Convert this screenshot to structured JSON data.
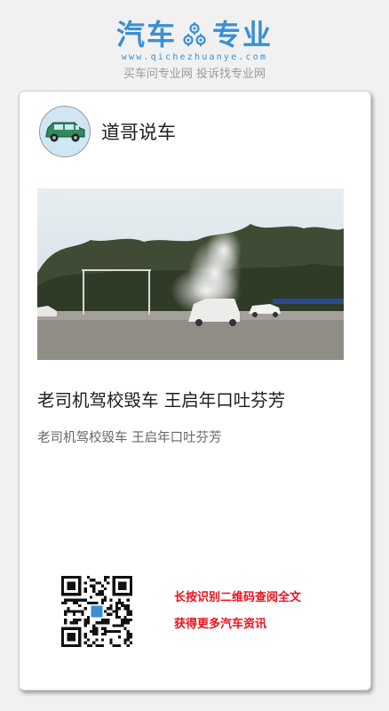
{
  "brand": {
    "name_left": "汽车",
    "name_right": "专业",
    "logo_icon": "gears-icon",
    "domain": "www.qichezhuanye.com",
    "slogan": "买车问专业网 投诉找专业网",
    "color": "#3a8fd4"
  },
  "author": {
    "name": "道哥说车",
    "avatar_icon": "green-car-avatar"
  },
  "article": {
    "title": "老司机驾校毁车  王启年口吐芬芳",
    "subtitle": "老司机驾校毁车  王启年口吐芬芳",
    "image": "car-crash-smoke-photo"
  },
  "cta": {
    "line1": "长按识别二维码查阅全文",
    "line2": "获得更多汽车资讯",
    "color": "#e8121c"
  },
  "qr": {
    "icon": "qr-code-icon"
  }
}
